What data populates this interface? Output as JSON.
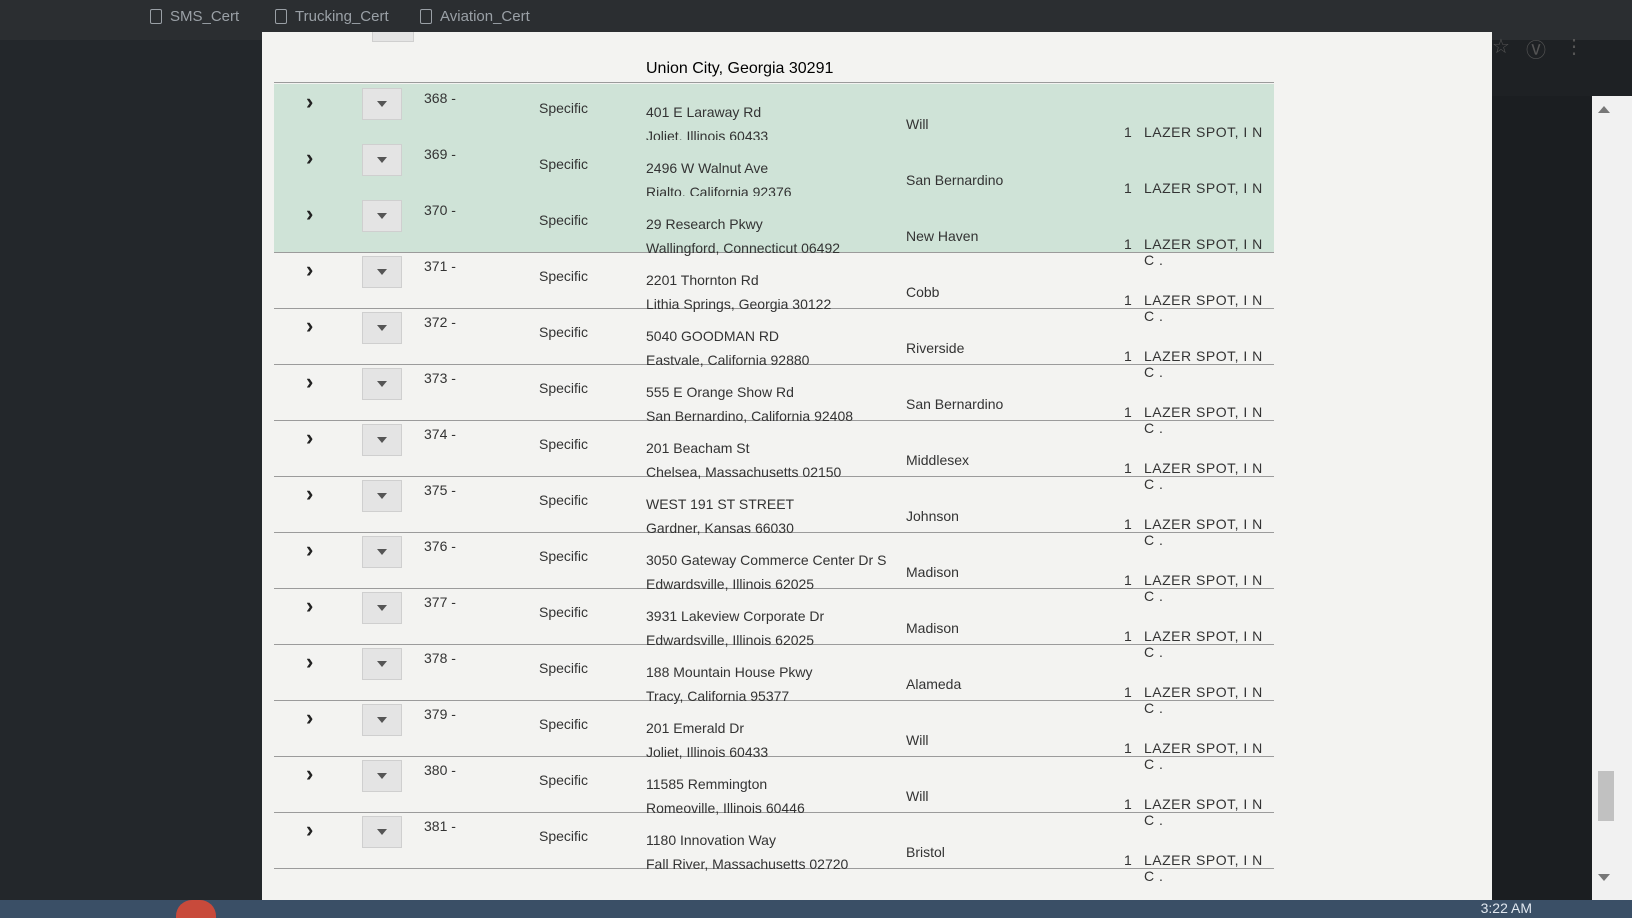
{
  "bookmarks": [
    {
      "label": "SMS_Cert"
    },
    {
      "label": "Trucking_Cert"
    },
    {
      "label": "Aviation_Cert"
    }
  ],
  "browser_tools": {
    "star_icon": "star-icon",
    "extension_icon": "v-extension-icon",
    "menu_icon": "kebab-menu-icon"
  },
  "partial_top": {
    "addr2": "Union City, Georgia 30291"
  },
  "rows": [
    {
      "num": "368 -",
      "type": "Specific",
      "addr1": "401 E Laraway Rd",
      "addr2": "Joliet, Illinois 60433",
      "county": "Will",
      "qty": "1",
      "company": "LAZER SPOT, I N C .",
      "highlight": true
    },
    {
      "num": "369 -",
      "type": "Specific",
      "addr1": "2496 W Walnut Ave",
      "addr2": "Rialto, California 92376",
      "county": "San Bernardino",
      "qty": "1",
      "company": "LAZER SPOT, I N C .",
      "highlight": true
    },
    {
      "num": "370 -",
      "type": "Specific",
      "addr1": "29 Research Pkwy",
      "addr2": "Wallingford, Connecticut 06492",
      "county": "New Haven",
      "qty": "1",
      "company": "LAZER SPOT, I N C .",
      "highlight": true
    },
    {
      "num": "371 -",
      "type": "Specific",
      "addr1": "2201 Thornton Rd",
      "addr2": "Lithia Springs, Georgia 30122",
      "county": "Cobb",
      "qty": "1",
      "company": "LAZER SPOT, I N C .",
      "highlight": false
    },
    {
      "num": "372 -",
      "type": "Specific",
      "addr1": "5040 GOODMAN RD",
      "addr2": "Eastvale, California 92880",
      "county": "Riverside",
      "qty": "1",
      "company": "LAZER SPOT, I N C .",
      "highlight": false
    },
    {
      "num": "373 -",
      "type": "Specific",
      "addr1": "555 E Orange Show Rd",
      "addr2": "San Bernardino, California 92408",
      "county": "San Bernardino",
      "qty": "1",
      "company": "LAZER SPOT, I N C .",
      "highlight": false
    },
    {
      "num": "374 -",
      "type": "Specific",
      "addr1": "201 Beacham St",
      "addr2": "Chelsea, Massachusetts 02150",
      "county": "Middlesex",
      "qty": "1",
      "company": "LAZER SPOT, I N C .",
      "highlight": false
    },
    {
      "num": "375 -",
      "type": "Specific",
      "addr1": "WEST 191 ST STREET",
      "addr2": "Gardner, Kansas 66030",
      "county": "Johnson",
      "qty": "1",
      "company": "LAZER SPOT, I N C .",
      "highlight": false
    },
    {
      "num": "376 -",
      "type": "Specific",
      "addr1": "3050 Gateway Commerce Center Dr S",
      "addr2": "Edwardsville, Illinois 62025",
      "county": "Madison",
      "qty": "1",
      "company": "LAZER SPOT, I N C .",
      "highlight": false
    },
    {
      "num": "377 -",
      "type": "Specific",
      "addr1": "3931 Lakeview Corporate Dr",
      "addr2": "Edwardsville, Illinois 62025",
      "county": "Madison",
      "qty": "1",
      "company": "LAZER SPOT, I N C .",
      "highlight": false
    },
    {
      "num": "378 -",
      "type": "Specific",
      "addr1": "188 Mountain House Pkwy",
      "addr2": "Tracy, California 95377",
      "county": "Alameda",
      "qty": "1",
      "company": "LAZER SPOT, I N C .",
      "highlight": false
    },
    {
      "num": "379 -",
      "type": "Specific",
      "addr1": "201 Emerald Dr",
      "addr2": "Joliet, Illinois 60433",
      "county": "Will",
      "qty": "1",
      "company": "LAZER SPOT, I N C .",
      "highlight": false
    },
    {
      "num": "380 -",
      "type": "Specific",
      "addr1": "11585 Remmington",
      "addr2": "Romeoville, Illinois 60446",
      "county": "Will",
      "qty": "1",
      "company": "LAZER SPOT, I N C .",
      "highlight": false
    },
    {
      "num": "381 -",
      "type": "Specific",
      "addr1": "1180 Innovation Way",
      "addr2": "Fall River, Massachusetts 02720",
      "county": "Bristol",
      "qty": "1",
      "company": "LAZER SPOT, I N C .",
      "highlight": false
    }
  ],
  "taskbar": {
    "clock": "3:22 AM"
  },
  "colors": {
    "row_highlight": "#cfe3d7",
    "page_bg": "#f3f3f1",
    "taskbar": "#3a4f66"
  }
}
